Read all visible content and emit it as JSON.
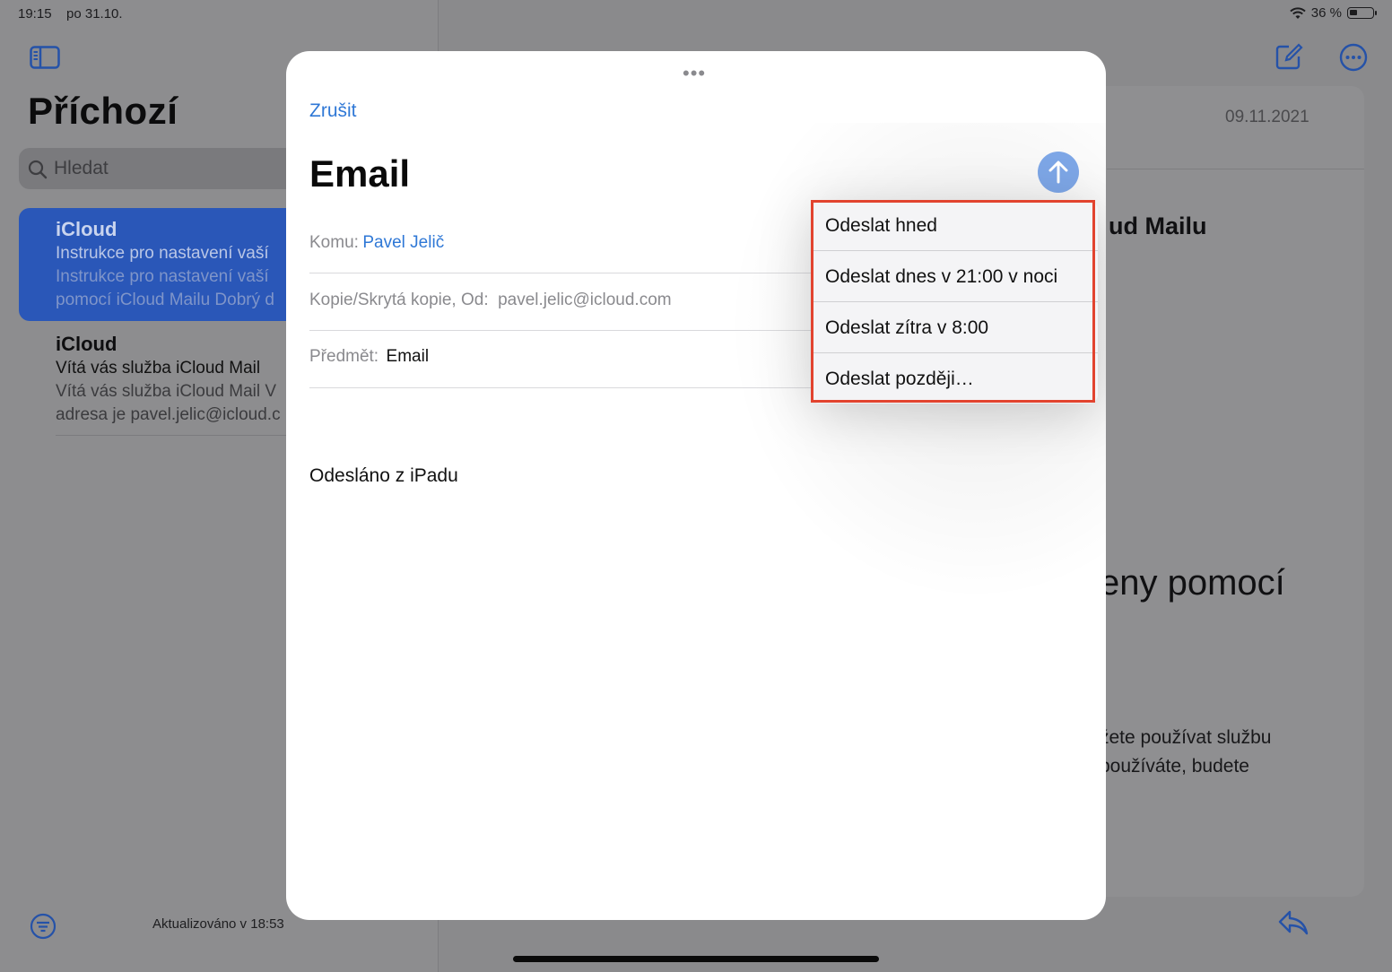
{
  "status_bar": {
    "time": "19:15",
    "date": "po 31.10.",
    "battery": "36 %",
    "battery_level": 0.36
  },
  "sidebar": {
    "title": "Příchozí",
    "search_placeholder": "Hledat",
    "mails": [
      {
        "from": "iCloud",
        "subject": "Instrukce pro nastavení vaší",
        "preview1": "Instrukce pro nastavení vaší",
        "preview2": "pomocí iCloud Mailu Dobrý d"
      },
      {
        "from": "iCloud",
        "subject": "Vítá vás služba iCloud Mail",
        "preview1": "Vítá vás služba iCloud Mail V",
        "preview2": "adresa je pavel.jelic@icloud.c"
      }
    ],
    "updated": "Aktualizováno v 18:53"
  },
  "detail": {
    "date": "09.11.2021",
    "heading": "ud Mailu",
    "big_text": "eny pomocí",
    "para1": "žete používat službu",
    "para2": "používáte, budete"
  },
  "compose": {
    "cancel": "Zrušit",
    "title": "Email",
    "to_label": "Komu:",
    "to_value": "Pavel Jelič",
    "cc_label": "Kopie/Skrytá kopie, Od:",
    "cc_value": "pavel.jelic@icloud.com",
    "subject_label": "Předmět:",
    "subject_value": "Email",
    "body": "Odesláno z iPadu"
  },
  "send_menu": {
    "items": [
      "Odeslat hned",
      "Odeslat dnes v 21:00 v noci",
      "Odeslat zítra v 8:00",
      "Odeslat později…"
    ]
  },
  "colors": {
    "accent": "#2f78d6",
    "highlight": "#e2442f",
    "send_button": "#7da6e6"
  }
}
